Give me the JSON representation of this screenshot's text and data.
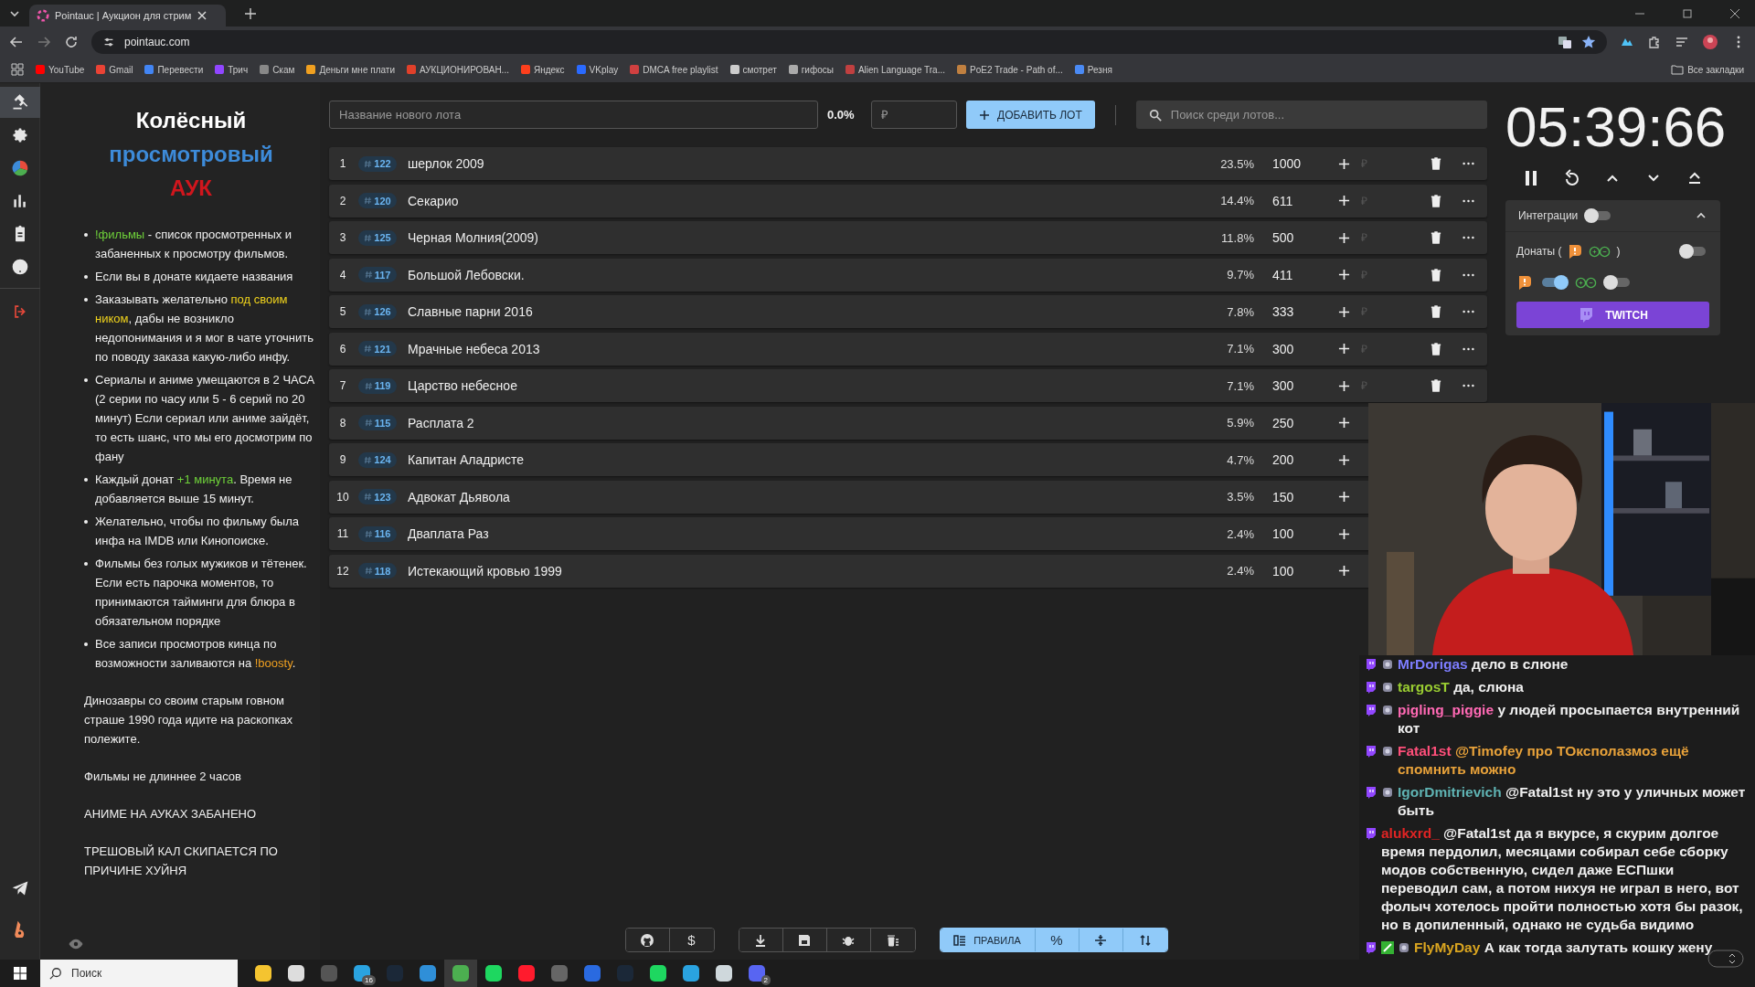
{
  "browser": {
    "tab_title": "Pointauc | Аукцион для стрим",
    "url": "pointauc.com",
    "bookmarks": [
      "YouTube",
      "Gmail",
      "Перевести",
      "Трич",
      "Скам",
      "Деньги мне плати",
      "АУКЦИОНИРОВАН...",
      "Яндекс",
      "VKplay",
      "DMCA free playlist",
      "смотрет",
      "гифосы",
      "Alien Language Tra...",
      "PoE2 Trade - Path of...",
      "Резня"
    ],
    "all_bookmarks": "Все закладки"
  },
  "nav": [
    {
      "selected": true
    },
    {
      "selected": false
    },
    {
      "selected": false
    },
    {
      "selected": false
    },
    {
      "selected": false
    },
    {
      "selected": false
    },
    {
      "selected": false
    }
  ],
  "rules": {
    "title": [
      {
        "text": "Колёсный",
        "color": "#ffffff"
      },
      {
        "text": "просмотровый",
        "color": "#3d8bd9"
      },
      {
        "text": "АУК",
        "color": "#d0161d"
      }
    ],
    "items": [
      [
        {
          "text": "!фильмы",
          "color": "#6fd23a"
        },
        {
          "text": " - список просмотренных и забаненных к просмотру фильмов."
        }
      ],
      [
        {
          "text": "Если вы в донате кидаете названия"
        }
      ],
      [
        {
          "text": "Заказывать желательно "
        },
        {
          "text": "под своим ником",
          "color": "#f0d31c"
        },
        {
          "text": ", дабы не возникло недопонимания и я мог в чате уточнить по поводу заказа какую-либо инфу."
        }
      ],
      [
        {
          "text": "Сериалы и аниме умещаются в 2 ЧАСА (2 серии по часу или 5 - 6 серий по 20 минут) Если сериал или аниме зайдёт, то есть шанс, что мы его досмотрим по фану"
        }
      ],
      [
        {
          "text": "Каждый донат "
        },
        {
          "text": "+1 минута",
          "color": "#6fd23a"
        },
        {
          "text": ". Время не добавляется выше 15 минут."
        }
      ],
      [
        {
          "text": "Желательно, чтобы по фильму была инфа на IMDB или Кинопоиске."
        }
      ],
      [
        {
          "text": "Фильмы без голых мужиков и тётенек. Если есть парочка моментов, то принимаются тайминги для блюра в обязательном порядке"
        }
      ],
      [
        {
          "text": "Все записи просмотров кинца по возможности заливаются на "
        },
        {
          "text": "!boosty",
          "color": "#f0a020"
        },
        {
          "text": "."
        }
      ]
    ],
    "notes": [
      "Динозавры со своим старым говном страше 1990 года идите на раскопках полежите.",
      "Фильмы не длиннее 2 часов",
      "АНИМЕ НА АУКАХ ЗАБАНЕНО",
      "ТРЕШОВЫЙ КАЛ СКИПАЕТСЯ ПО ПРИЧИНЕ ХУЙНЯ"
    ]
  },
  "lot_form": {
    "name_placeholder": "Название нового лота",
    "percent": "0.0%",
    "amount_placeholder": "₽",
    "add_button": "ДОБАВИТЬ ЛОТ",
    "search_placeholder": "Поиск среди лотов..."
  },
  "lots": [
    {
      "index": "1",
      "id": "122",
      "name": "шерлок 2009",
      "percent": "23.5%",
      "amount": "1000",
      "add_placeholder": "₽"
    },
    {
      "index": "2",
      "id": "120",
      "name": "Секарио",
      "percent": "14.4%",
      "amount": "611",
      "add_placeholder": "₽"
    },
    {
      "index": "3",
      "id": "125",
      "name": "Черная Молния(2009)",
      "percent": "11.8%",
      "amount": "500",
      "add_placeholder": "₽"
    },
    {
      "index": "4",
      "id": "117",
      "name": "Большой Лебовски.",
      "percent": "9.7%",
      "amount": "411",
      "add_placeholder": "₽"
    },
    {
      "index": "5",
      "id": "126",
      "name": "Славные парни 2016",
      "percent": "7.8%",
      "amount": "333",
      "add_placeholder": "₽"
    },
    {
      "index": "6",
      "id": "121",
      "name": "Мрачные небеса 2013",
      "percent": "7.1%",
      "amount": "300",
      "add_placeholder": "₽"
    },
    {
      "index": "7",
      "id": "119",
      "name": "Царство небесное",
      "percent": "7.1%",
      "amount": "300",
      "add_placeholder": "₽"
    },
    {
      "index": "8",
      "id": "115",
      "name": "Расплата 2",
      "percent": "5.9%",
      "amount": "250"
    },
    {
      "index": "9",
      "id": "124",
      "name": "Капитан Аладристе",
      "percent": "4.7%",
      "amount": "200"
    },
    {
      "index": "10",
      "id": "123",
      "name": "Адвокат Дьявола",
      "percent": "3.5%",
      "amount": "150"
    },
    {
      "index": "11",
      "id": "116",
      "name": "Дваплата Раз",
      "percent": "2.4%",
      "amount": "100"
    },
    {
      "index": "12",
      "id": "118",
      "name": "Истекающий кровью 1999",
      "percent": "2.4%",
      "amount": "100"
    }
  ],
  "toolbar": {
    "donate_label": "$",
    "rules_label": "ПРАВИЛА",
    "rules_active": true,
    "percent_label": "%"
  },
  "timer": {
    "time": "05:39:66"
  },
  "integrations": {
    "title": "Интеграции",
    "on": false,
    "expanded": true,
    "donations_label_start": "Донаты (",
    "donations_label_end": ")",
    "donations_on": false,
    "services": [
      {
        "on": true
      },
      {
        "on": false
      }
    ],
    "twitch_button": "TWITCH"
  },
  "chat": [
    {
      "user": "MrDorigas",
      "color": "#7d7dff",
      "text": "дело в слюне",
      "user_badge": true,
      "check_badge": false,
      "highlighted": false
    },
    {
      "user": "targosT",
      "color": "#9acd32",
      "text": "да, слюна",
      "user_badge": true,
      "check_badge": false,
      "highlighted": false
    },
    {
      "user": "pigling_piggie",
      "color": "#ff69b4",
      "text": "у людей просыпается внутренний кот",
      "user_badge": true,
      "check_badge": false,
      "highlighted": false
    },
    {
      "user": "Fatal1st",
      "color": "#ff4f7a",
      "text": "@Timofey про ТОксполазмоз ещё спомнить можно",
      "user_badge": true,
      "check_badge": false,
      "highlighted": true
    },
    {
      "user": "IgorDmitrievich",
      "color": "#5fb3b3",
      "text": "@Fatal1st ну это у уличных может быть",
      "user_badge": true,
      "check_badge": false,
      "highlighted": false
    },
    {
      "user": "alukxrd_",
      "color": "#e02424",
      "text": "@Fatal1st да я вкурсе, я скурим долгое время пердолил, месяцами собирал себе сборку модов собственную, сидел даже ЕСПшки переводил сам, а потом нихуя не играл в него, вот фолыч хотелось пройти полностью хотя бы разок, но в допиленный, однако не судьба видимо",
      "user_badge": false,
      "check_badge": false,
      "highlighted": false
    },
    {
      "user": "FlyMyDay",
      "color": "#daa520",
      "text": "А как тогда залутать кошку жену",
      "user_badge": true,
      "check_badge": true,
      "highlighted": false
    }
  ],
  "taskbar": {
    "search_placeholder": "Поиск",
    "apps": [
      {
        "active": false
      },
      {
        "active": false
      },
      {
        "active": false
      },
      {
        "active": false,
        "badge": "16"
      },
      {
        "active": false
      },
      {
        "active": false
      },
      {
        "active": true
      },
      {
        "active": false
      },
      {
        "active": false
      },
      {
        "active": false
      },
      {
        "active": false
      },
      {
        "active": false
      },
      {
        "active": false
      },
      {
        "active": false
      },
      {
        "active": false
      },
      {
        "active": false,
        "badge": "2"
      }
    ]
  }
}
